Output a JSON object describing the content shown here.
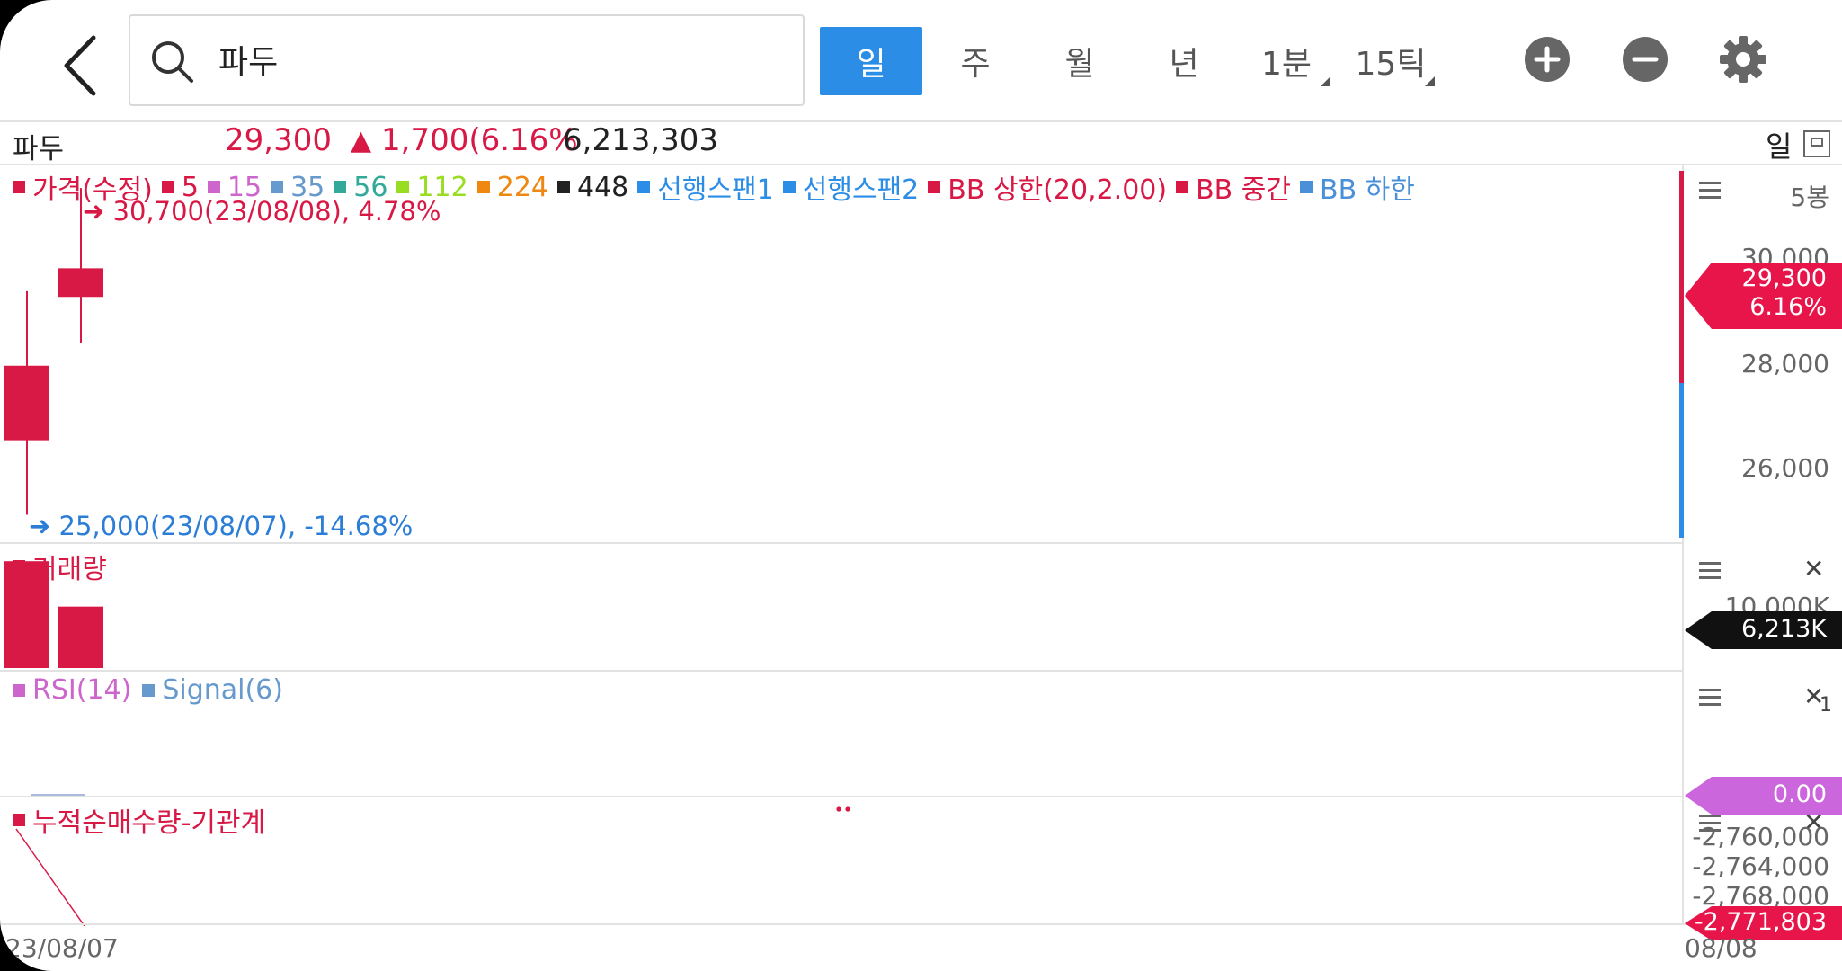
{
  "search": {
    "query": "파두"
  },
  "periods": [
    {
      "label": "일",
      "active": true
    },
    {
      "label": "주",
      "active": false
    },
    {
      "label": "월",
      "active": false
    },
    {
      "label": "년",
      "active": false
    },
    {
      "label": "1분",
      "active": false
    },
    {
      "label": "15틱",
      "active": false
    }
  ],
  "quote": {
    "symbol": "파두",
    "price": "29,300",
    "change": "1,700(6.16%",
    "volume": "6,213,303",
    "period": "일"
  },
  "legend": [
    {
      "label": "가격(수정)",
      "color": "#d81845"
    },
    {
      "label": "5",
      "color": "#d81845"
    },
    {
      "label": "15",
      "color": "#cc66cc"
    },
    {
      "label": "35",
      "color": "#6699cc"
    },
    {
      "label": "56",
      "color": "#33aa99"
    },
    {
      "label": "112",
      "color": "#99dd22"
    },
    {
      "label": "224",
      "color": "#ee8811"
    },
    {
      "label": "448",
      "color": "#222222"
    },
    {
      "label": "선행스팬1",
      "color": "#2b8de6"
    },
    {
      "label": "선행스팬2",
      "color": "#2b8de6"
    },
    {
      "label": "BB 상한(20,2.00)",
      "color": "#d81845"
    },
    {
      "label": "BB 중간",
      "color": "#d81845"
    },
    {
      "label": "BB 하한",
      "color": "#4a90d9"
    }
  ],
  "annotations": {
    "high": "30,700(23/08/08), 4.78%",
    "low": "25,000(23/08/07), -14.68%"
  },
  "price_panel": {
    "bar_count": "5봉",
    "y_ticks": [
      "30,000",
      "28,000",
      "26,000"
    ],
    "current_tag": {
      "price": "29,300",
      "pct": "6.16%"
    }
  },
  "volume_panel": {
    "label": "거래량",
    "y_tick": "10,000K",
    "current_tag": "6,213K"
  },
  "rsi_panel": {
    "label_rsi": "RSI(14)",
    "label_signal": "Signal(6)",
    "current_tag": "0.00",
    "sub_mark": "1"
  },
  "inst_panel": {
    "label": "누적순매수량-기관계",
    "y_ticks": [
      "-2,760,000",
      "-2,764,000",
      "-2,768,000"
    ],
    "current_tag": "-2,771,803"
  },
  "x_axis": {
    "left": "23/08/07",
    "right": "08/08"
  },
  "chart_data": {
    "type": "candlestick",
    "candles": [
      {
        "date": "23/08/07",
        "open": 26300,
        "high": 28900,
        "low": 25000,
        "close": 27600,
        "color": "#d81845"
      },
      {
        "date": "23/08/08",
        "open": 28800,
        "high": 30700,
        "low": 28000,
        "close": 29300,
        "color": "#d81845"
      }
    ],
    "volume_k": [
      10800,
      6213
    ],
    "colors": {
      "up": "#d81845",
      "down": "#2b8de6",
      "accent": "#2b8de6"
    }
  }
}
